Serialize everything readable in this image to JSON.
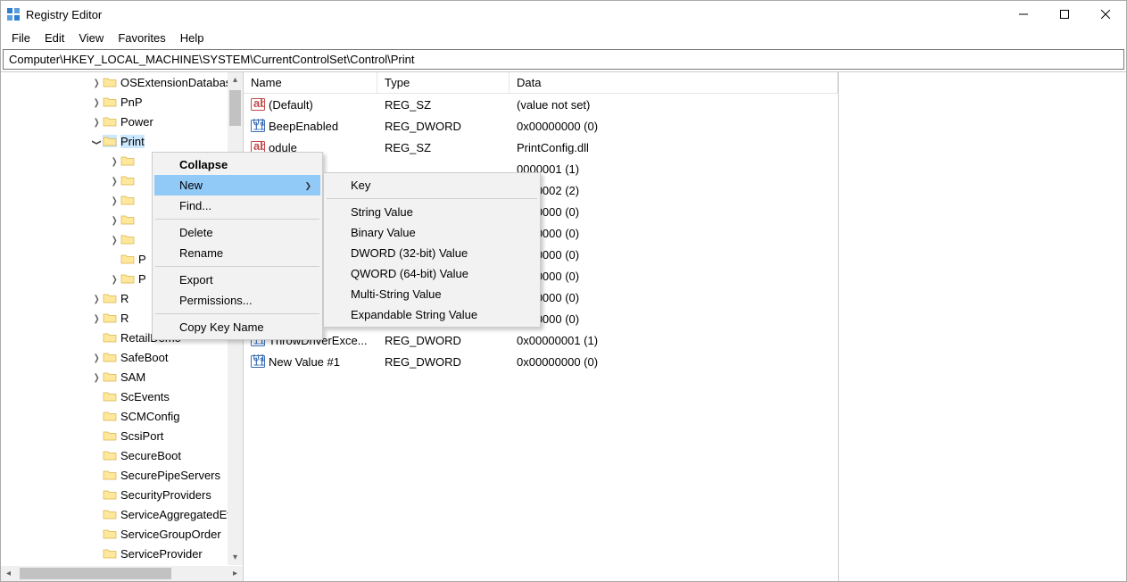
{
  "window": {
    "title": "Registry Editor"
  },
  "menu": {
    "file": "File",
    "edit": "Edit",
    "view": "View",
    "favorites": "Favorites",
    "help": "Help"
  },
  "address": "Computer\\HKEY_LOCAL_MACHINE\\SYSTEM\\CurrentControlSet\\Control\\Print",
  "tree": {
    "items": [
      {
        "indent": 190,
        "chev": ">",
        "label": "OSExtensionDatabase"
      },
      {
        "indent": 190,
        "chev": ">",
        "label": "PnP"
      },
      {
        "indent": 190,
        "chev": ">",
        "label": "Power"
      },
      {
        "indent": 190,
        "chev": "v",
        "label": "Print",
        "selected": true
      },
      {
        "indent": 210,
        "chev": ">",
        "label": ""
      },
      {
        "indent": 210,
        "chev": ">",
        "label": ""
      },
      {
        "indent": 210,
        "chev": ">",
        "label": ""
      },
      {
        "indent": 210,
        "chev": ">",
        "label": ""
      },
      {
        "indent": 210,
        "chev": ">",
        "label": ""
      },
      {
        "indent": 210,
        "chev": "",
        "label": "P"
      },
      {
        "indent": 210,
        "chev": ">",
        "label": "P"
      },
      {
        "indent": 190,
        "chev": ">",
        "label": "R"
      },
      {
        "indent": 190,
        "chev": ">",
        "label": "R"
      },
      {
        "indent": 190,
        "chev": "",
        "label": "RetailDemo"
      },
      {
        "indent": 190,
        "chev": ">",
        "label": "SafeBoot"
      },
      {
        "indent": 190,
        "chev": ">",
        "label": "SAM"
      },
      {
        "indent": 190,
        "chev": "",
        "label": "ScEvents"
      },
      {
        "indent": 190,
        "chev": "",
        "label": "SCMConfig"
      },
      {
        "indent": 190,
        "chev": "",
        "label": "ScsiPort"
      },
      {
        "indent": 190,
        "chev": "",
        "label": "SecureBoot"
      },
      {
        "indent": 190,
        "chev": "",
        "label": "SecurePipeServers"
      },
      {
        "indent": 190,
        "chev": "",
        "label": "SecurityProviders"
      },
      {
        "indent": 190,
        "chev": "",
        "label": "ServiceAggregatedEvents"
      },
      {
        "indent": 190,
        "chev": "",
        "label": "ServiceGroupOrder"
      },
      {
        "indent": 190,
        "chev": "",
        "label": "ServiceProvider"
      }
    ]
  },
  "headers": {
    "name": "Name",
    "type": "Type",
    "data": "Data"
  },
  "values": [
    {
      "icon": "str",
      "name": "(Default)",
      "type": "REG_SZ",
      "data": "(value not set)"
    },
    {
      "icon": "bin",
      "name": "BeepEnabled",
      "type": "REG_DWORD",
      "data": "0x00000000 (0)"
    },
    {
      "icon": "str",
      "name": "ConfigModule",
      "nameVisible": "odule",
      "type": "REG_SZ",
      "data": "PrintConfig.dll"
    },
    {
      "icon": "bin",
      "type": "",
      "data": "0000001 (1)",
      "name": ""
    },
    {
      "icon": "bin",
      "type": "",
      "data": "0000002 (2)",
      "name": ""
    },
    {
      "icon": "bin",
      "type": "",
      "data": "0000000 (0)",
      "name": ""
    },
    {
      "icon": "bin",
      "type": "",
      "data": "0000000 (0)",
      "name": ""
    },
    {
      "icon": "bin",
      "type": "",
      "data": "0000000 (0)",
      "name": ""
    },
    {
      "icon": "bin",
      "type": "",
      "data": "0000000 (0)",
      "name": ""
    },
    {
      "icon": "bin",
      "type": "",
      "data": "0000000 (0)",
      "name": ""
    },
    {
      "icon": "bin",
      "type": "",
      "data": "0000000 (0)",
      "name": ""
    },
    {
      "icon": "bin",
      "name": "ThrowDriverExce...",
      "type": "REG_DWORD",
      "data": "0x00000001 (1)"
    },
    {
      "icon": "bin",
      "name": "New Value #1",
      "type": "REG_DWORD",
      "data": "0x00000000 (0)"
    }
  ],
  "ctx1": {
    "collapse": "Collapse",
    "new": "New",
    "find": "Find...",
    "delete": "Delete",
    "rename": "Rename",
    "export": "Export",
    "permissions": "Permissions...",
    "copykey": "Copy Key Name"
  },
  "ctx2": {
    "key": "Key",
    "string": "String Value",
    "binary": "Binary Value",
    "dword": "DWORD (32-bit) Value",
    "qword": "QWORD (64-bit) Value",
    "multi": "Multi-String Value",
    "expand": "Expandable String Value"
  }
}
